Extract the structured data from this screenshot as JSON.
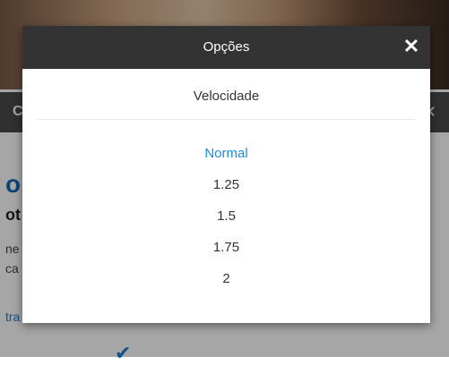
{
  "background": {
    "bar_left": "C",
    "bar_right": "✕",
    "title_fragment": "o",
    "subtitle_fragment": "ot",
    "line1_fragment": "ne",
    "line2_fragment": "ca",
    "link_fragment": "tra"
  },
  "modal": {
    "title": "Opções",
    "close_icon": "✕",
    "section_title": "Velocidade",
    "options": [
      {
        "label": "Normal",
        "selected": true
      },
      {
        "label": "1.25",
        "selected": false
      },
      {
        "label": "1.5",
        "selected": false
      },
      {
        "label": "1.75",
        "selected": false
      },
      {
        "label": "2",
        "selected": false
      }
    ]
  },
  "colors": {
    "header_bg": "#333333",
    "selected": "#1b8fd8",
    "text": "#333333"
  }
}
